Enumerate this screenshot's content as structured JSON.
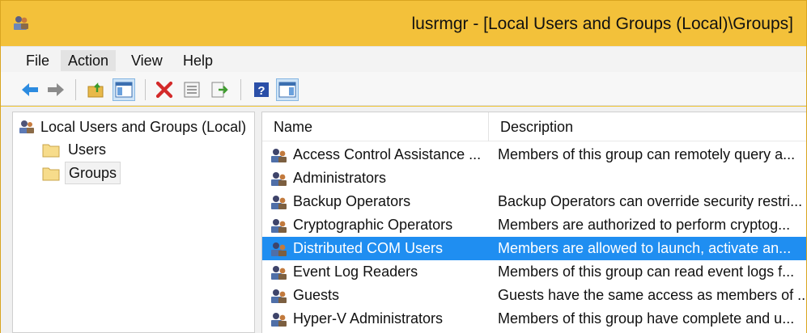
{
  "window": {
    "title": "lusrmgr - [Local Users and Groups (Local)\\Groups]",
    "accent_color": "#f3c13a"
  },
  "menu": {
    "items": [
      "File",
      "Action",
      "View",
      "Help"
    ]
  },
  "toolbar": {
    "buttons": [
      "back-icon",
      "forward-icon",
      "up-folder-icon",
      "show-hide-tree-icon",
      "delete-icon",
      "properties-icon",
      "export-list-icon",
      "help-icon",
      "show-hide-action-pane-icon"
    ]
  },
  "tree": {
    "root": "Local Users and Groups (Local)",
    "children": [
      "Users",
      "Groups"
    ],
    "selected": "Groups"
  },
  "list": {
    "columns": [
      "Name",
      "Description"
    ],
    "rows": [
      {
        "name": "Access Control Assistance ...",
        "description": "Members of this group can remotely query a..."
      },
      {
        "name": "Administrators",
        "description": ""
      },
      {
        "name": "Backup Operators",
        "description": "Backup Operators can override security restri..."
      },
      {
        "name": "Cryptographic Operators",
        "description": "Members are authorized to perform cryptog..."
      },
      {
        "name": "Distributed COM Users",
        "description": "Members are allowed to launch, activate an..."
      },
      {
        "name": "Event Log Readers",
        "description": "Members of this group can read event logs f..."
      },
      {
        "name": "Guests",
        "description": "Guests have the same access as members of ..."
      },
      {
        "name": "Hyper-V Administrators",
        "description": "Members of this group have complete and u..."
      }
    ],
    "selected_row": "Distributed COM Users",
    "selection_color": "#1f8ef1"
  }
}
